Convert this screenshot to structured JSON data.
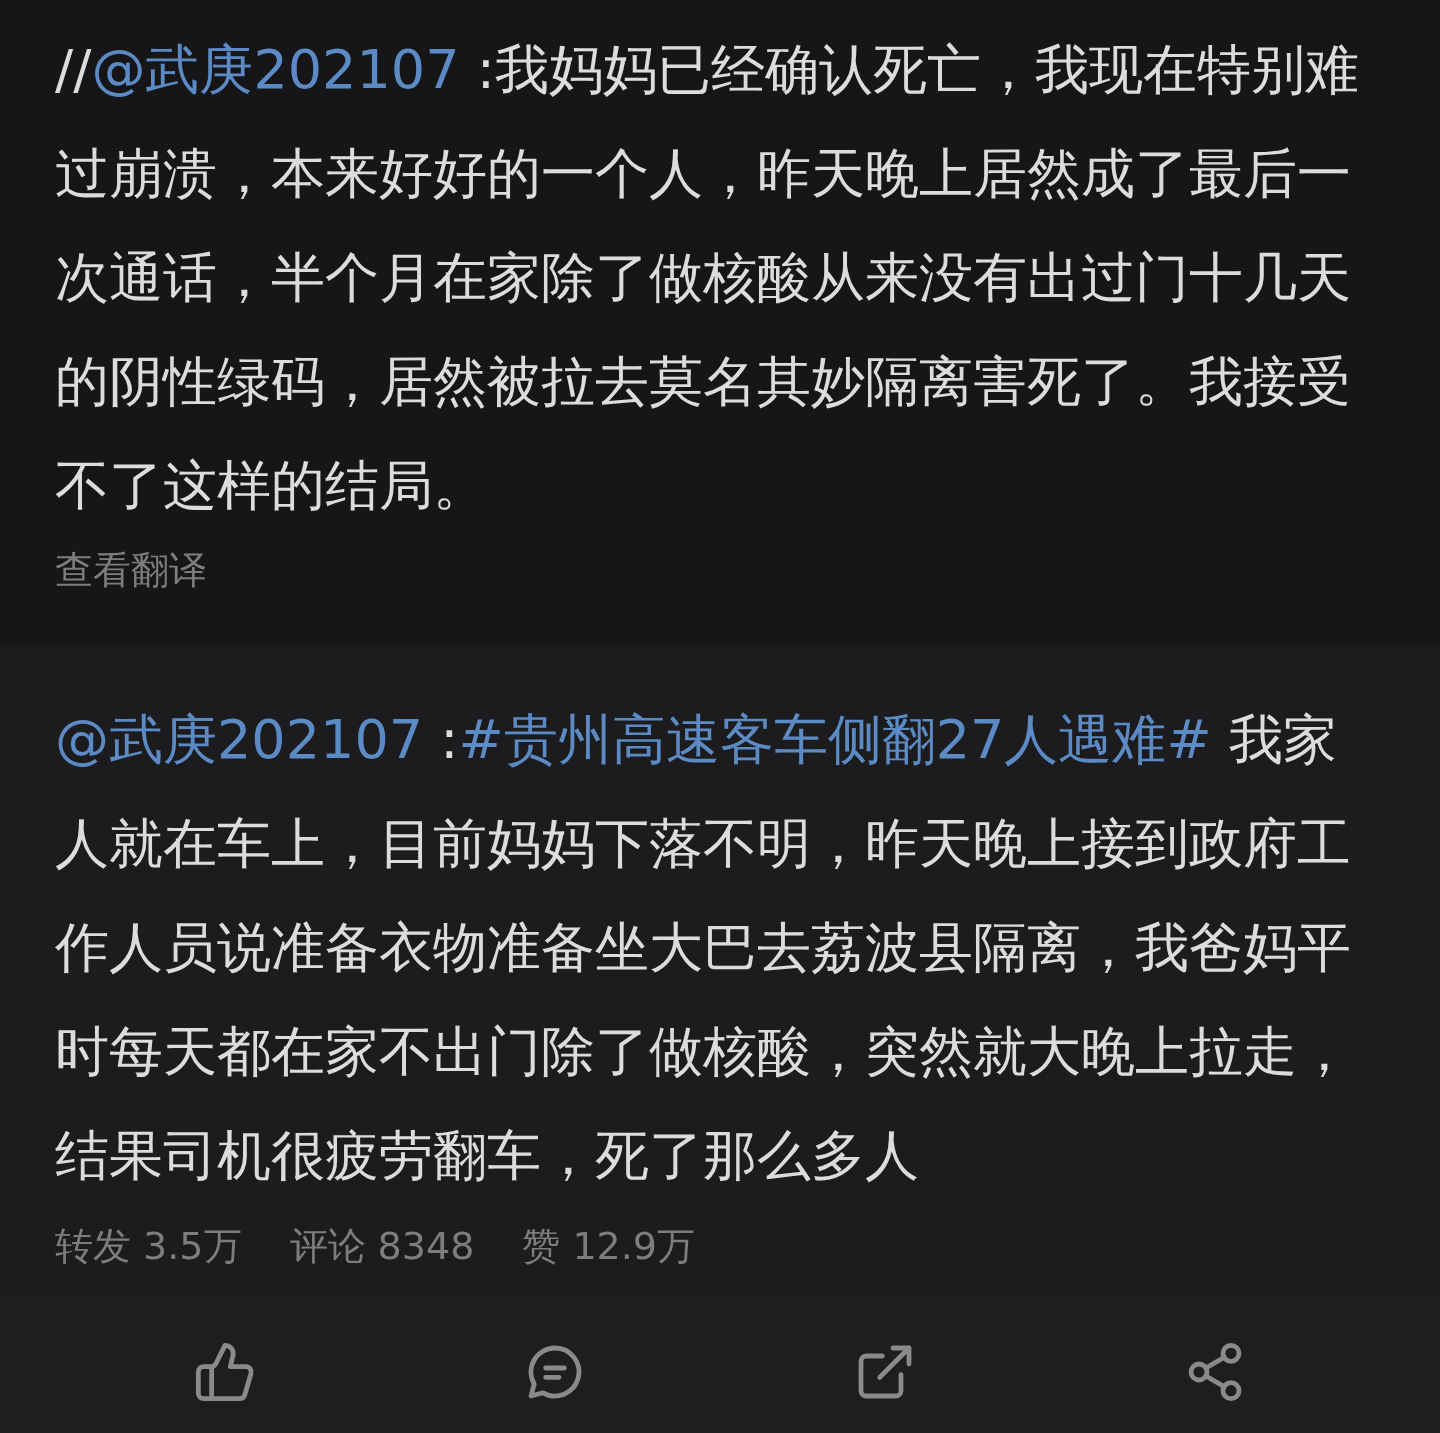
{
  "repost": {
    "segments": [
      {
        "kind": "text",
        "text": "//"
      },
      {
        "kind": "mention",
        "text": "@武庚202107"
      },
      {
        "kind": "text",
        "text": " :我妈妈已经确认死亡，我现在特别难过崩溃，本来好好的一个人，昨天晚上居然成了最后一次通话，半个月在家除了做核酸从来没有出过门十几天的阴性绿码，居然被拉去莫名其妙隔离害死了。我接受不了这样的结局。"
      }
    ],
    "translate_link": "查看翻译"
  },
  "original": {
    "segments": [
      {
        "kind": "mention",
        "text": "@武庚202107"
      },
      {
        "kind": "text",
        "text": " :"
      },
      {
        "kind": "hashtag",
        "text": "#贵州高速客车侧翻27人遇难#"
      },
      {
        "kind": "text",
        "text": " 我家人就在车上，目前妈妈下落不明，昨天晚上接到政府工作人员说准备衣物准备坐大巴去荔波县隔离，我爸妈平时每天都在家不出门除了做核酸，突然就大晚上拉走，结果司机很疲劳翻车，死了那么多人"
      }
    ],
    "stats": [
      "转发 3.5万",
      "评论 8348",
      "赞 12.9万"
    ]
  },
  "actions": [
    {
      "kind": "like"
    },
    {
      "kind": "comment"
    },
    {
      "kind": "forward"
    },
    {
      "kind": "share"
    }
  ]
}
